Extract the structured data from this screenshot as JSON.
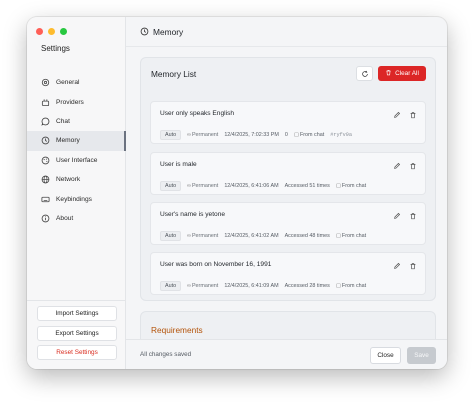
{
  "app": {
    "sidebar_title": "Settings",
    "nav_items": [
      {
        "label": "General",
        "icon": "gear-icon"
      },
      {
        "label": "Providers",
        "icon": "providers-icon"
      },
      {
        "label": "Chat",
        "icon": "chat-icon"
      },
      {
        "label": "Memory",
        "icon": "memory-icon",
        "active": true
      },
      {
        "label": "User Interface",
        "icon": "palette-icon"
      },
      {
        "label": "Network",
        "icon": "globe-icon"
      },
      {
        "label": "Keybindings",
        "icon": "keyboard-icon"
      },
      {
        "label": "About",
        "icon": "info-icon"
      }
    ],
    "bottom_buttons": {
      "import": "Import Settings",
      "export": "Export Settings",
      "reset": "Reset Settings"
    }
  },
  "header": {
    "title": "Memory",
    "icon": "memory-icon"
  },
  "memory_list": {
    "title": "Memory List",
    "refresh_icon": "refresh-icon",
    "clear_label": "Clear All",
    "items": [
      {
        "text": "User only speaks English",
        "type": "Auto",
        "scope": "Permanent",
        "date": "12/4/2025, 7:02:33 PM",
        "accessed": "0",
        "source": "From chat",
        "chat_id": "#ryfv9a"
      },
      {
        "text": "User is male",
        "type": "Auto",
        "scope": "Permanent",
        "date": "12/4/2025, 6:41:06 AM",
        "accessed": "Accessed 51 times",
        "source": "From chat",
        "chat_id": ""
      },
      {
        "text": "User's name is yetone",
        "type": "Auto",
        "scope": "Permanent",
        "date": "12/4/2025, 6:41:02 AM",
        "accessed": "Accessed 48 times",
        "source": "From chat",
        "chat_id": ""
      },
      {
        "text": "User was born on November 16, 1991",
        "type": "Auto",
        "scope": "Permanent",
        "date": "12/4/2025, 6:41:09 AM",
        "accessed": "Accessed 28 times",
        "source": "From chat",
        "chat_id": ""
      }
    ]
  },
  "requirements": {
    "title": "Requirements"
  },
  "footer": {
    "status": "All changes saved",
    "close_label": "Close",
    "save_label": "Save"
  },
  "colors": {
    "danger": "#dc2626",
    "requirements_title": "#b45309",
    "save_disabled": "#c6cacf"
  }
}
